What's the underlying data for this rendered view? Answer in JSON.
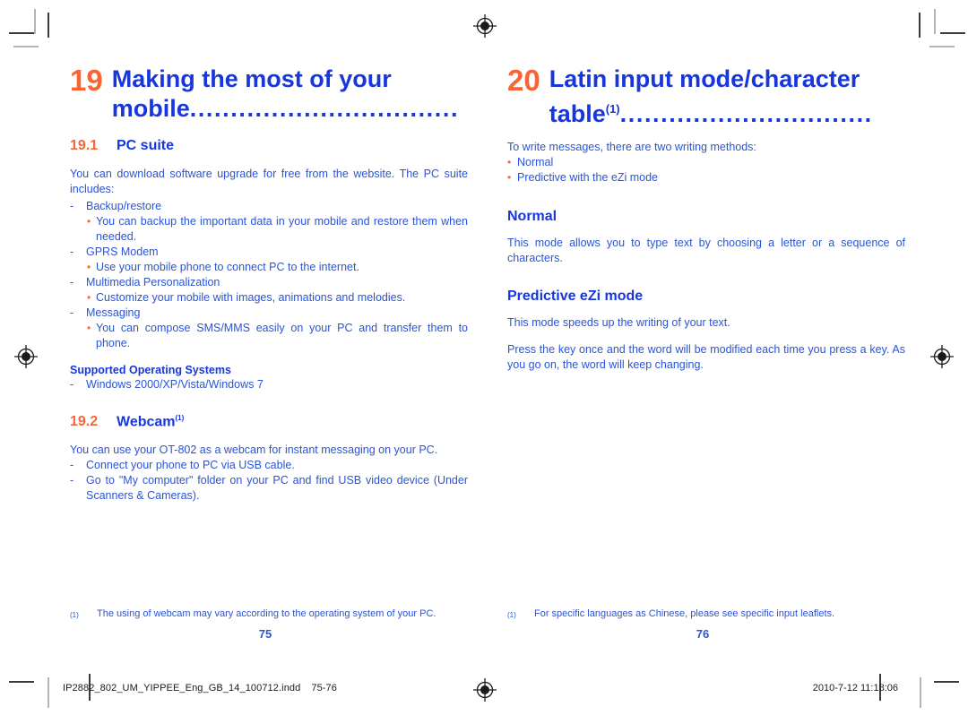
{
  "document": {
    "left_page": {
      "chapter": {
        "number": "19",
        "title": "Making the most of your mobile",
        "leader": "................................."
      },
      "section1": {
        "number": "19.1",
        "name": "PC suite"
      },
      "intro": "You can download software upgrade for free from the website. The PC suite includes:",
      "items": [
        {
          "marker": "-",
          "label": "Backup/restore",
          "bullets": [
            {
              "marker": "•",
              "text": "You can backup the important data in your mobile and restore them when needed."
            }
          ]
        },
        {
          "marker": "-",
          "label": "GPRS Modem",
          "bullets": [
            {
              "marker": "•",
              "text": "Use your mobile phone to connect PC to the internet."
            }
          ]
        },
        {
          "marker": "-",
          "label": "Multimedia Personalization",
          "bullets": [
            {
              "marker": "•",
              "text": "Customize your mobile with images, animations and melodies."
            }
          ]
        },
        {
          "marker": "-",
          "label": "Messaging",
          "bullets": [
            {
              "marker": "•",
              "text": "You can compose SMS/MMS easily on your PC and transfer them to phone."
            }
          ]
        }
      ],
      "supported_title": "Supported Operating Systems",
      "supported_item": {
        "marker": "-",
        "text": "Windows 2000/XP/Vista/Windows 7"
      },
      "section2": {
        "number": "19.2",
        "name": "Webcam",
        "sup": "(1)"
      },
      "webcam_intro": "You can use your OT-802 as a webcam for instant messaging on your PC.",
      "webcam_steps": [
        {
          "marker": "-",
          "text": "Connect your phone to PC via USB cable."
        },
        {
          "marker": "-",
          "text": "Go to \"My computer\" folder on your PC and find USB video device (Under Scanners & Cameras)."
        }
      ],
      "footnote": {
        "mark": "(1)",
        "text": "The using of webcam may vary according to the operating system of your PC."
      },
      "page_number": "75"
    },
    "right_page": {
      "chapter": {
        "number": "20",
        "title": "Latin input mode/character table",
        "sup": "(1)",
        "leader": "..............................."
      },
      "intro": "To write messages, there are two writing methods:",
      "methods": [
        {
          "marker": "•",
          "text": "Normal"
        },
        {
          "marker": "•",
          "text": "Predictive with the eZi mode"
        }
      ],
      "normal": {
        "heading": "Normal",
        "body": "This mode allows you to type text by choosing a letter or a sequence of characters."
      },
      "predictive": {
        "heading": "Predictive eZi mode",
        "body1": "This mode speeds up the writing of your text.",
        "body2": "Press the key once and the word will be modified each time you press a key. As you go on, the word will keep changing."
      },
      "footnote": {
        "mark": "(1)",
        "text": "For specific languages as Chinese, please see specific input leaflets."
      },
      "page_number": "76"
    }
  },
  "print_bar": {
    "filename": "IP2882_802_UM_YIPPEE_Eng_GB_14_100712.indd",
    "page_range": "75-76",
    "timestamp": "2010-7-12   11:18:06"
  },
  "colors": {
    "orange": "#f96432",
    "heading_blue": "#1736dd",
    "body_blue": "#2a54d8"
  }
}
